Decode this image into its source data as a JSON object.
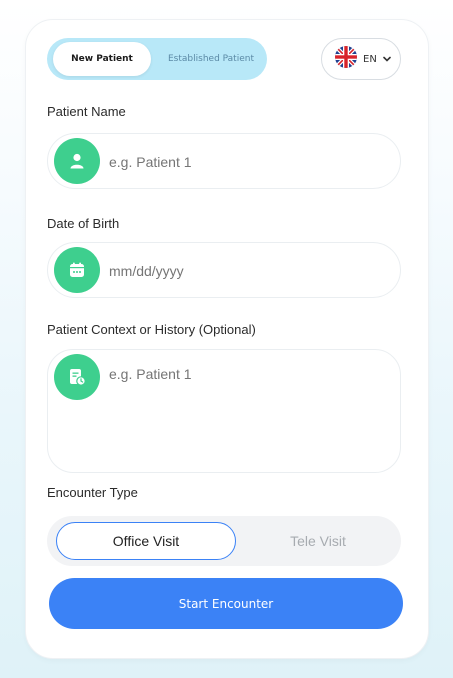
{
  "patient_toggle": {
    "active_label": "New Patient",
    "inactive_label": "Established Patient"
  },
  "language": {
    "code": "EN",
    "flag_icon": "uk-flag-icon",
    "chevron_icon": "chevron-down-icon"
  },
  "fields": {
    "patient_name": {
      "label": "Patient Name",
      "placeholder": "e.g. Patient 1",
      "icon": "user-icon"
    },
    "date_of_birth": {
      "label": "Date of Birth",
      "placeholder": "mm/dd/yyyy",
      "icon": "calendar-icon"
    },
    "context": {
      "label": "Patient Context or History (Optional)",
      "placeholder": "e.g. Patient 1",
      "icon": "clipboard-history-icon"
    }
  },
  "encounter": {
    "label": "Encounter Type",
    "options": [
      "Office Visit",
      "Tele Visit"
    ],
    "selected": "Office Visit"
  },
  "start_button": {
    "label": "Start Encounter"
  },
  "colors": {
    "accent_green": "#3ecf8e",
    "primary_blue": "#3b82f6",
    "toggle_bg": "#b8e8f8"
  }
}
